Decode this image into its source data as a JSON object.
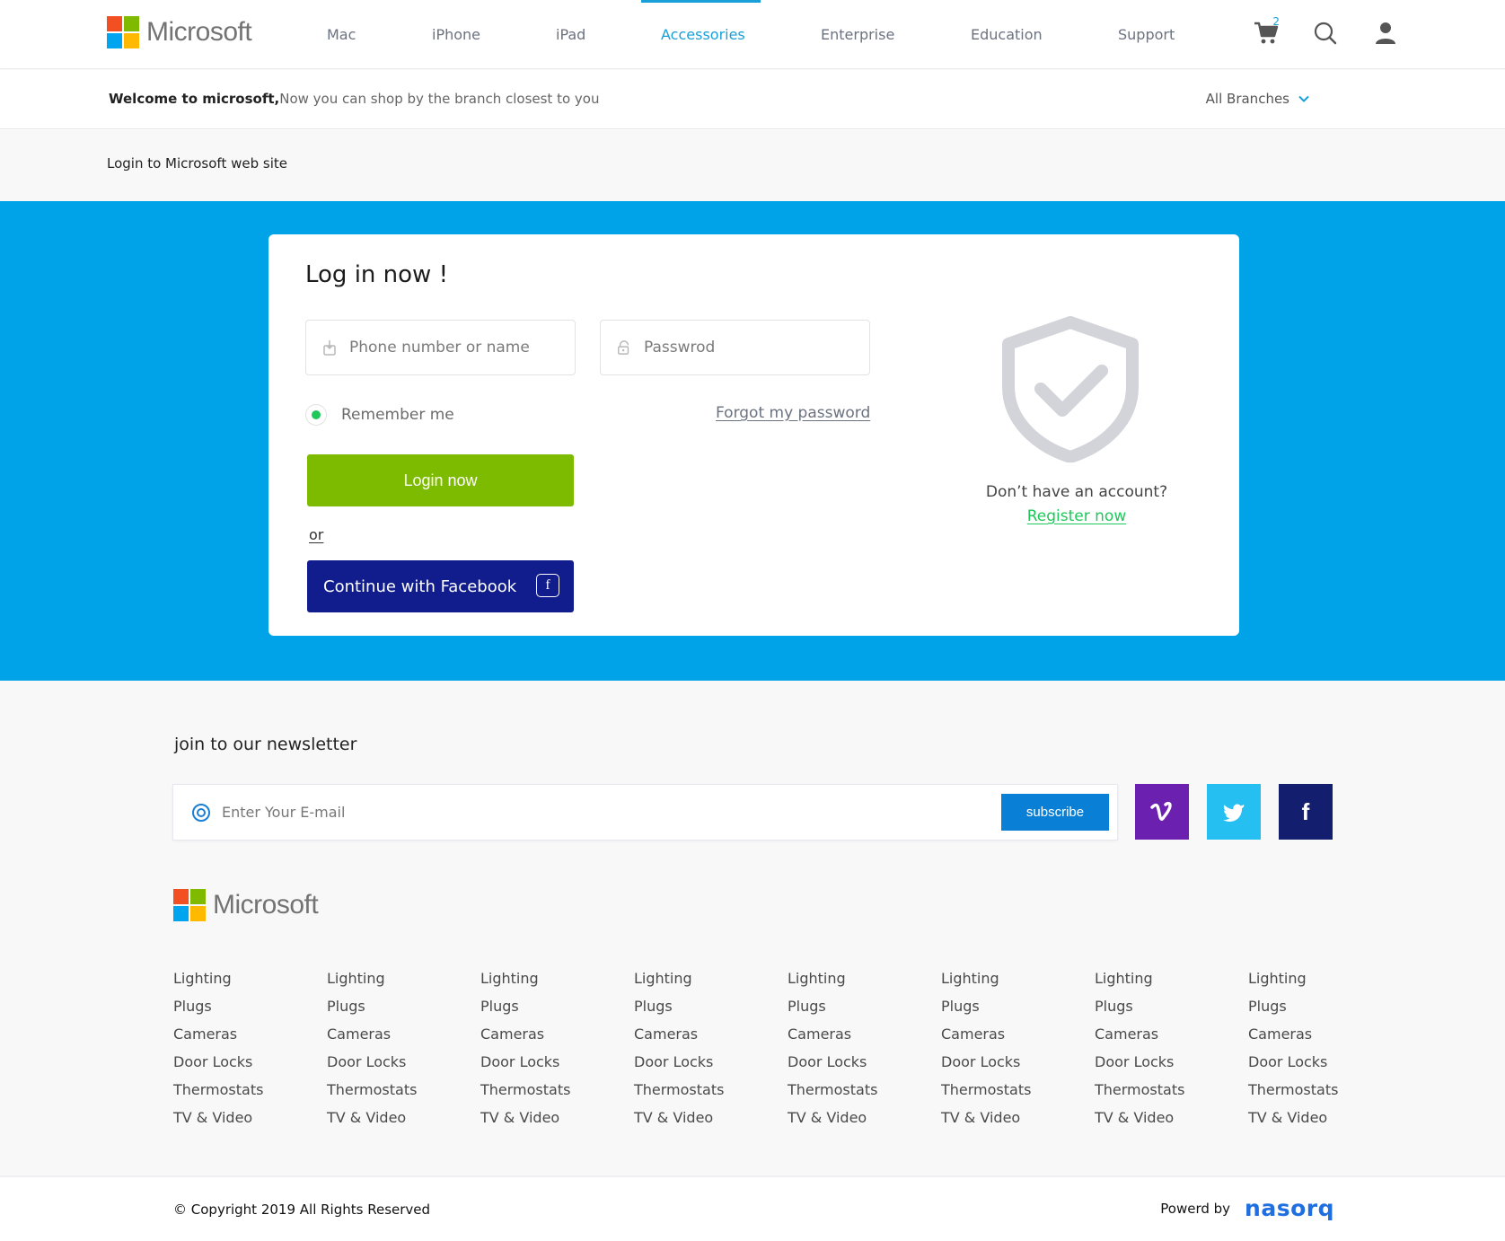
{
  "brand": {
    "name": "Microsoft"
  },
  "nav": {
    "items": [
      {
        "label": "Mac"
      },
      {
        "label": "iPhone"
      },
      {
        "label": "iPad"
      },
      {
        "label": "Accessories",
        "active": true
      },
      {
        "label": "Enterprise"
      },
      {
        "label": "Education"
      },
      {
        "label": "Support"
      }
    ],
    "cart_count": "2",
    "icons": [
      "cart-icon",
      "search-icon",
      "user-icon"
    ]
  },
  "welcome": {
    "bold": "Welcome to microsoft,",
    "text": "Now you can shop by the branch closest to you",
    "branches_label": "All Branches"
  },
  "breadcrumb": "Login to Microsoft web site",
  "login": {
    "title": "Log in now !",
    "username_placeholder": "Phone number or name",
    "password_placeholder": "Passwrod",
    "remember_label": "Remember me",
    "remember_checked": true,
    "forgot_label": "Forgot my password",
    "login_button": "Login now",
    "or_label": "or",
    "facebook_button": "Continue with Facebook",
    "no_account": "Don’t have an account?",
    "register_label": "Register now"
  },
  "newsletter": {
    "title": "join to our newsletter",
    "placeholder": "Enter Your E-mail",
    "button": "subscribe",
    "social": [
      "vimeo-icon",
      "twitter-icon",
      "facebook-icon"
    ]
  },
  "footer_columns": [
    [
      "Lighting",
      "Plugs",
      "Cameras",
      "Door Locks",
      "Thermostats",
      "TV & Video"
    ],
    [
      "Lighting",
      "Plugs",
      "Cameras",
      "Door Locks",
      "Thermostats",
      "TV & Video"
    ],
    [
      "Lighting",
      "Plugs",
      "Cameras",
      "Door Locks",
      "Thermostats",
      "TV & Video"
    ],
    [
      "Lighting",
      "Plugs",
      "Cameras",
      "Door Locks",
      "Thermostats",
      "TV & Video"
    ],
    [
      "Lighting",
      "Plugs",
      "Cameras",
      "Door Locks",
      "Thermostats",
      "TV & Video"
    ],
    [
      "Lighting",
      "Plugs",
      "Cameras",
      "Door Locks",
      "Thermostats",
      "TV & Video"
    ],
    [
      "Lighting",
      "Plugs",
      "Cameras",
      "Door Locks",
      "Thermostats",
      "TV & Video"
    ],
    [
      "Lighting",
      "Plugs",
      "Cameras",
      "Door Locks",
      "Thermostats",
      "TV & Video"
    ]
  ],
  "bottom": {
    "copyright": "© Copyright 2019 All Rights Reserved",
    "powered_by": "Powerd by",
    "powered_brand": "nasorq"
  },
  "colors": {
    "accent": "#1aa0d8",
    "band": "#00a3e8",
    "login_button": "#7dbb00",
    "facebook_button": "#111d8c",
    "register_link": "#1ec85a",
    "subscribe_button": "#0a7fd6",
    "vimeo": "#6c20b0",
    "twitter": "#25bff1",
    "facebook_tile": "#141e6e"
  }
}
